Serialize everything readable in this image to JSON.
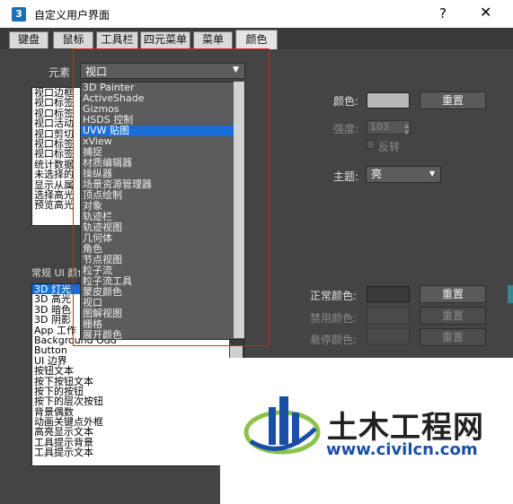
{
  "window": {
    "app_icon": "3",
    "title": "自定义用户界面",
    "help_glyph": "?",
    "close_glyph": "✕"
  },
  "tabs": [
    {
      "label": "键盘",
      "active": false
    },
    {
      "label": "鼠标",
      "active": false
    },
    {
      "label": "工具栏",
      "active": false
    },
    {
      "label": "四元菜单",
      "active": false
    },
    {
      "label": "菜单",
      "active": false
    },
    {
      "label": "颜色",
      "active": true
    }
  ],
  "element": {
    "label": "元素",
    "selected": "视口",
    "options": [
      "3D Painter",
      "ActiveShade",
      "Gizmos",
      "HSDS 控制",
      "UVW 贴图",
      "xView",
      "捕捉",
      "材质编辑器",
      "操纵器",
      "场景资源管理器",
      "顶点绘制",
      "对象",
      "轨迹栏",
      "轨迹视图",
      "几何体",
      "角色",
      "节点视图",
      "粒子流",
      "粒子流工具",
      "蒙皮颜色",
      "视口",
      "图解视图",
      "栅格",
      "展开颜色"
    ],
    "highlighted_index": 4
  },
  "viewport_list": {
    "items": [
      "视口边框",
      "视口标签",
      "视口标签",
      "视口活动",
      "视口剪切",
      "视口标签",
      "视口标签",
      "统计数据",
      "未选择的",
      "显示从属",
      "选择高光",
      "预览高光"
    ]
  },
  "ui_colors": {
    "label": "常规 UI 颜色",
    "items": [
      "3D 灯光",
      "3D 高光",
      "3D 暗色",
      "3D 阴影",
      "App 工作",
      "Background Odd",
      "Button",
      "UI 边界",
      "按钮文本",
      "按下按钮文本",
      "按下的按钮",
      "按下的层次按钮",
      "背景偶数",
      "动画关键点外框",
      "高亮显示文本",
      "工具提示背景",
      "工具提示文本"
    ],
    "selected_index": 0
  },
  "color_panel": {
    "color_label": "颜色:",
    "reset_label": "重置",
    "intensity_label": "强度:",
    "intensity_value": "103",
    "invert_label": "反转",
    "theme_label": "主题:",
    "theme_value": "亮",
    "normal_color_label": "正常颜色:",
    "disabled_color_label": "禁用颜色:",
    "hover_color_label": "悬停颜色:"
  },
  "colors": {
    "panel_bg": "#444444",
    "swatch_light": "#b8b8b8",
    "swatch_dark": "#3a3a3a",
    "selection": "#1a6fd6",
    "highlight_box": "#e02020"
  },
  "watermark": {
    "title": "土木工程网",
    "url": "www.civilcn.com"
  }
}
